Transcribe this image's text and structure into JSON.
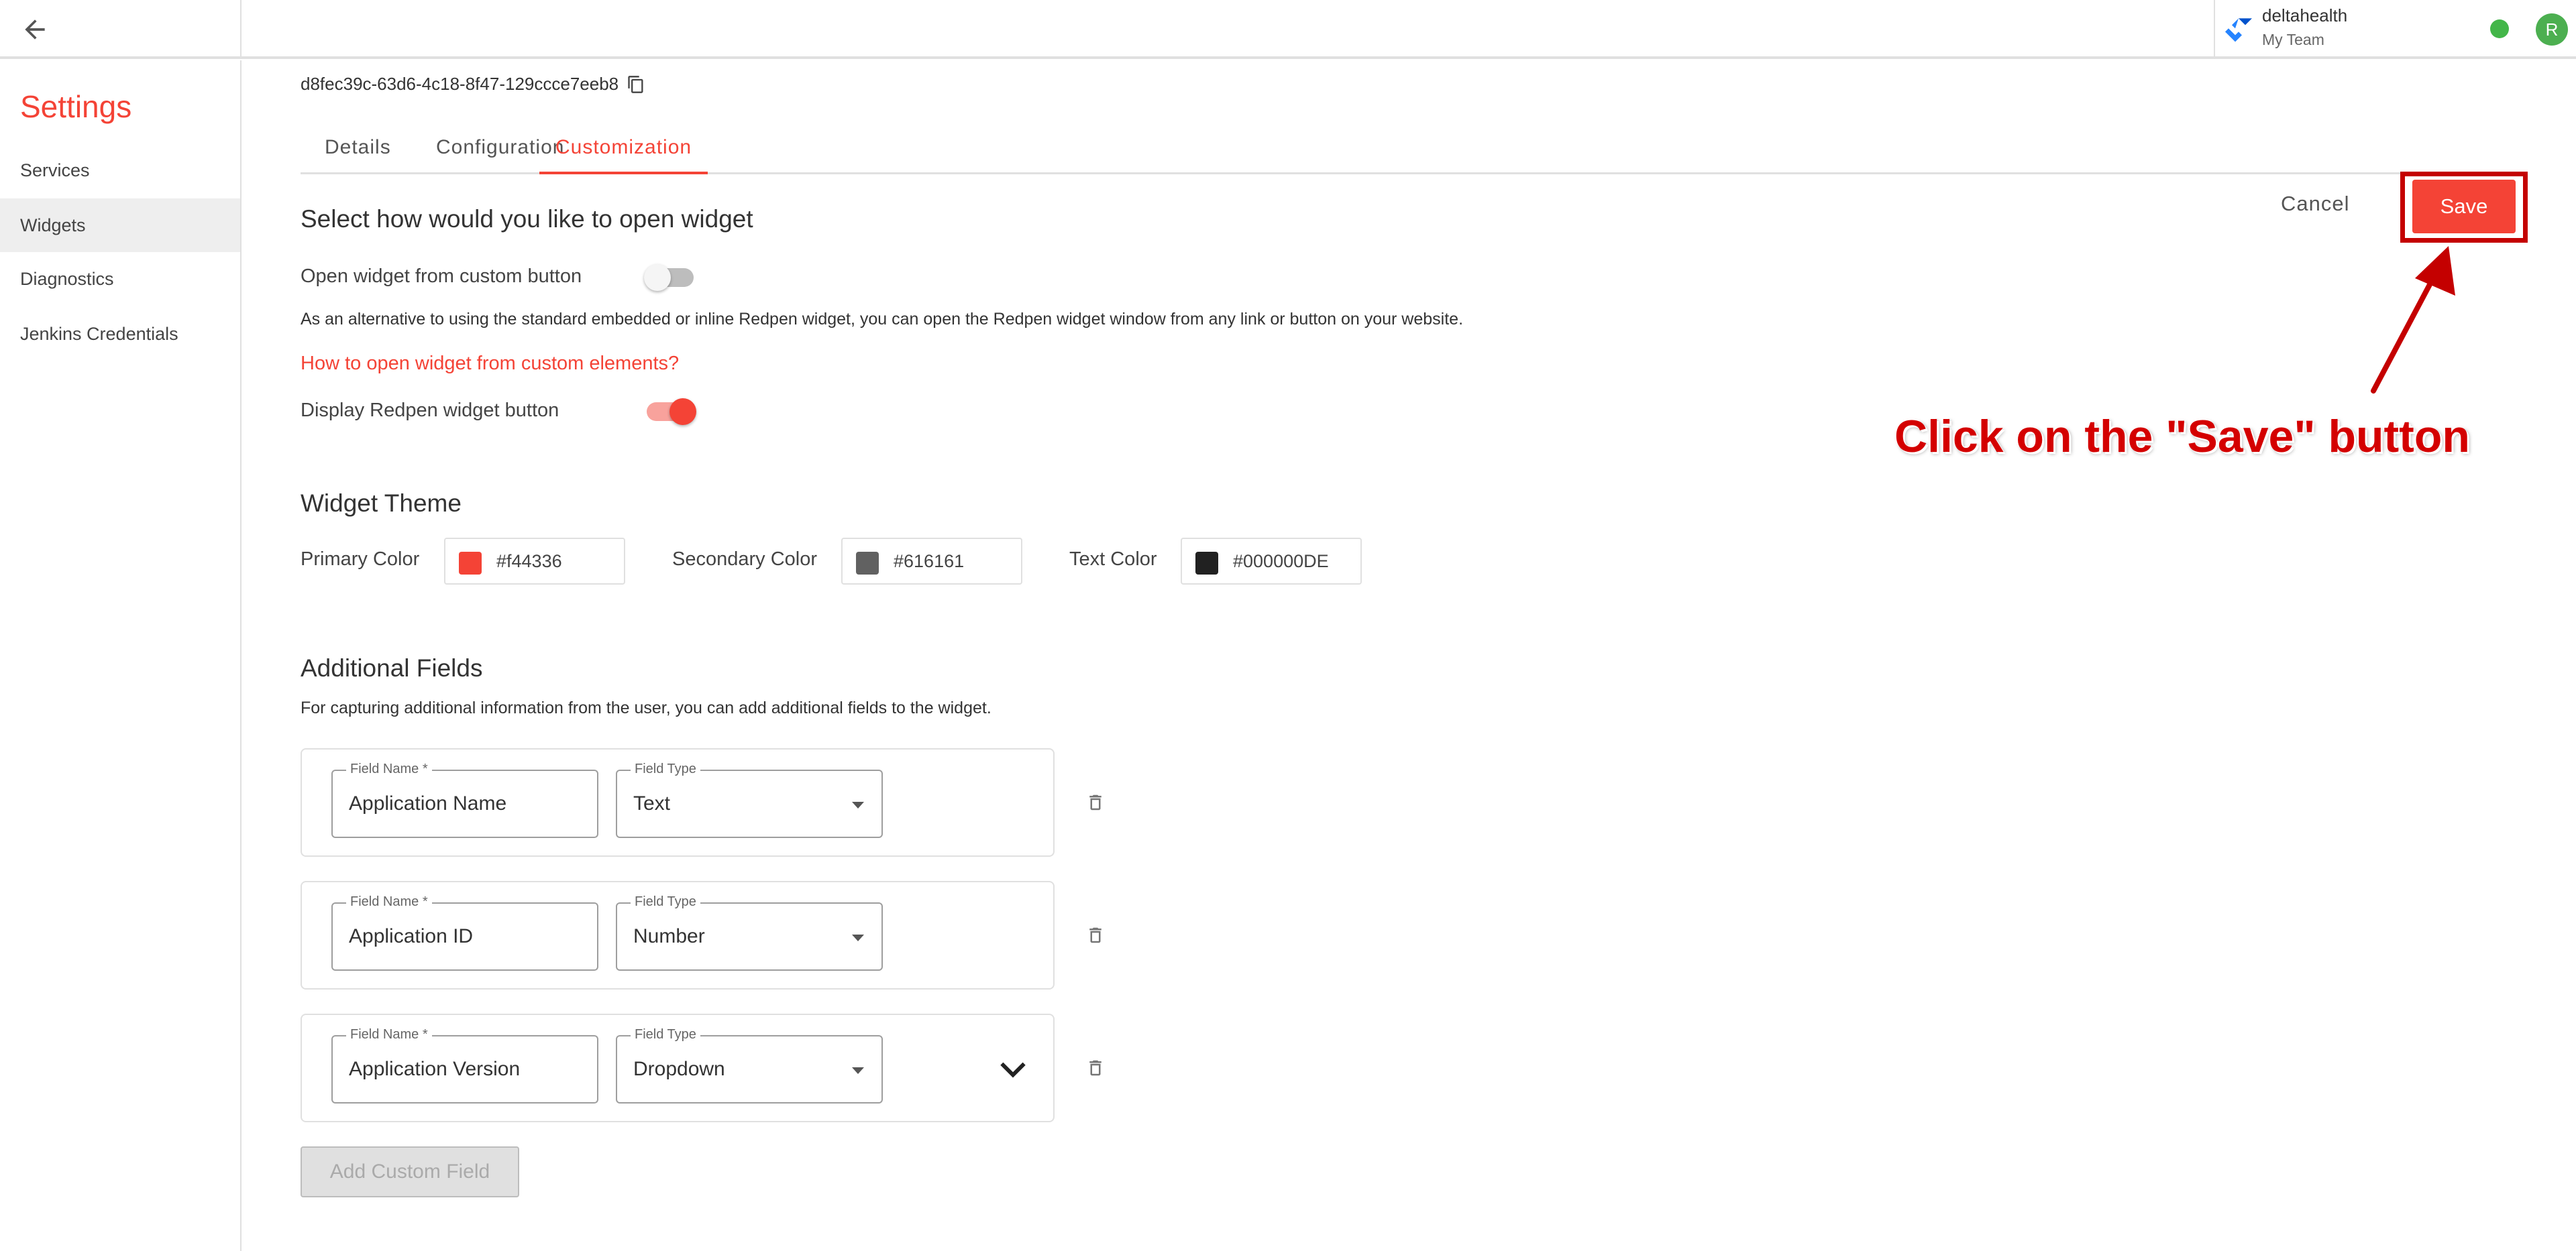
{
  "header": {
    "team_name": "deltahealth",
    "team_subtitle": "My Team",
    "avatar_letter": "R"
  },
  "sidebar": {
    "title": "Settings",
    "items": [
      {
        "label": "Services"
      },
      {
        "label": "Widgets"
      },
      {
        "label": "Diagnostics"
      },
      {
        "label": "Jenkins Credentials"
      }
    ]
  },
  "widget": {
    "id": "d8fec39c-63d6-4c18-8f47-129ccce7eeb8",
    "tabs": [
      {
        "label": "Details"
      },
      {
        "label": "Configuration"
      },
      {
        "label": "Customization"
      }
    ]
  },
  "open_widget": {
    "heading": "Select how would you like to open widget",
    "custom_button_label": "Open widget from custom button",
    "custom_button_enabled": false,
    "description": "As an alternative to using the standard embedded or inline Redpen widget, you can open the Redpen widget window from any link or button on your website.",
    "help_link": "How to open widget from custom elements?",
    "display_button_label": "Display Redpen widget button",
    "display_button_enabled": true
  },
  "theme": {
    "heading": "Widget Theme",
    "primary": {
      "label": "Primary Color",
      "value": "#f44336"
    },
    "secondary": {
      "label": "Secondary Color",
      "value": "#616161"
    },
    "text": {
      "label": "Text Color",
      "value": "#000000DE"
    }
  },
  "additional_fields": {
    "heading": "Additional Fields",
    "description": "For capturing additional information from the user, you can add additional fields to the widget.",
    "name_label": "Field Name *",
    "type_label": "Field Type",
    "rows": [
      {
        "name": "Application Name",
        "type": "Text"
      },
      {
        "name": "Application ID",
        "type": "Number"
      },
      {
        "name": "Application Version",
        "type": "Dropdown"
      }
    ],
    "add_button": "Add Custom Field"
  },
  "actions": {
    "cancel": "Cancel",
    "save": "Save"
  },
  "annotation": {
    "text": "Click on the \"Save\" button"
  },
  "colors": {
    "accent": "#f44336",
    "annotation": "#d40000",
    "status_online": "#43b649"
  }
}
